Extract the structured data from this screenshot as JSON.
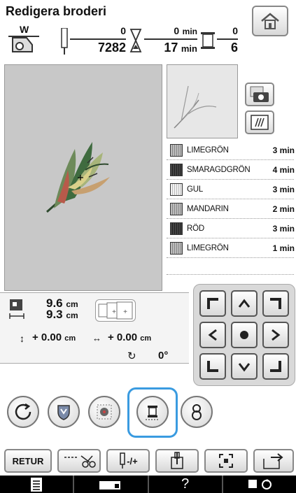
{
  "title": "Redigera broderi",
  "header": {
    "presser_foot_label": "W",
    "stitch_current": "0",
    "stitch_total": "7282",
    "time_current": "0",
    "time_current_unit": "min",
    "time_total": "17",
    "time_total_unit": "min",
    "color_current": "0",
    "color_total": "6"
  },
  "thread_list": [
    {
      "name": "LIMEGRÖN",
      "time": "3 min",
      "shade": "mid"
    },
    {
      "name": "SMARAGDGRÖN",
      "time": "4 min",
      "shade": "dark"
    },
    {
      "name": "GUL",
      "time": "3 min",
      "shade": "light"
    },
    {
      "name": "MANDARIN",
      "time": "2 min",
      "shade": "mid"
    },
    {
      "name": "RÖD",
      "time": "3 min",
      "shade": "dark"
    },
    {
      "name": "LIMEGRÖN",
      "time": "1 min",
      "shade": "mid"
    }
  ],
  "info": {
    "height_value": "9.6",
    "height_unit": "cm",
    "width_value": "9.3",
    "width_unit": "cm",
    "vertical_offset": "+ 0.00",
    "vertical_unit": "cm",
    "horizontal_offset": "+ 0.00",
    "horizontal_unit": "cm",
    "rotation": "0°"
  },
  "toolbar": {
    "retur_label": "RETUR",
    "needle_label": "-/+"
  },
  "bottom_bar": {
    "help_label": "?"
  }
}
